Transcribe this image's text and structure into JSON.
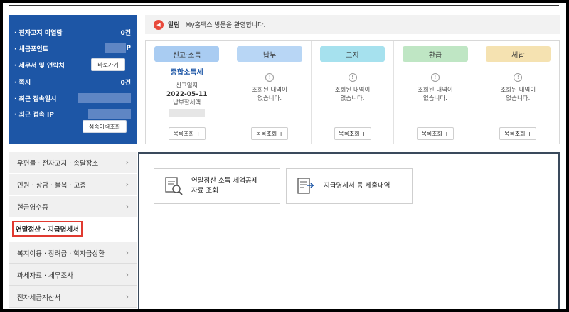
{
  "user_panel": {
    "rows": [
      {
        "label": "· 전자고지 미열람",
        "value": "0건"
      },
      {
        "label": "· 세금포인트",
        "value": "P"
      },
      {
        "label": "· 세무서 및 연락처",
        "button": "바로가기"
      },
      {
        "label": "· 쪽지",
        "value": "0건"
      },
      {
        "label": "· 최근 접속일시"
      },
      {
        "label": "· 최근 접속 IP"
      }
    ],
    "history_button": "접속이력조회"
  },
  "notice": {
    "title": "알림",
    "text": "My홈택스 방문을 환영합니다."
  },
  "status_columns": [
    {
      "tab": "신고·소득",
      "color": "#a9ccf2",
      "title": "종합소득세",
      "line1": "신고일자",
      "date": "2022-05-11",
      "line2": "납부할세액",
      "button": "목록조회 +"
    },
    {
      "tab": "납부",
      "color": "#b8d6f5",
      "msg1": "조회된 내역이",
      "msg2": "없습니다.",
      "button": "목록조회 +"
    },
    {
      "tab": "고지",
      "color": "#a6e1ee",
      "msg1": "조회된 내역이",
      "msg2": "없습니다.",
      "button": "목록조회 +"
    },
    {
      "tab": "환급",
      "color": "#bfe6c4",
      "msg1": "조회된 내역이",
      "msg2": "없습니다.",
      "button": "목록조회 +"
    },
    {
      "tab": "체납",
      "color": "#f5e2b1",
      "msg1": "조회된 내역이",
      "msg2": "없습니다.",
      "button": "목록조회 +"
    }
  ],
  "left_menu": [
    {
      "label": "우편물 · 전자고지 · 송달장소"
    },
    {
      "label": "민원 · 상담 · 불복 · 고충"
    },
    {
      "label": "현금영수증"
    },
    {
      "label": "연말정산 · 지급명세서",
      "active": true
    },
    {
      "label": "복지이용 · 장려금 · 학자금상환"
    },
    {
      "label": "과세자료 · 세무조사"
    },
    {
      "label": "전자세금계산서"
    }
  ],
  "content_cards": [
    {
      "line1": "연말정산 소득 세액공제",
      "line2": "자료 조회",
      "icon": "magnifier-document-icon"
    },
    {
      "line1": "지급명세서 등 제출내역",
      "line2": "",
      "icon": "document-export-icon"
    }
  ],
  "icons": {
    "notice": "megaphone-icon",
    "chevron": "chevron-right-icon",
    "status": "exclamation-circle-icon"
  }
}
